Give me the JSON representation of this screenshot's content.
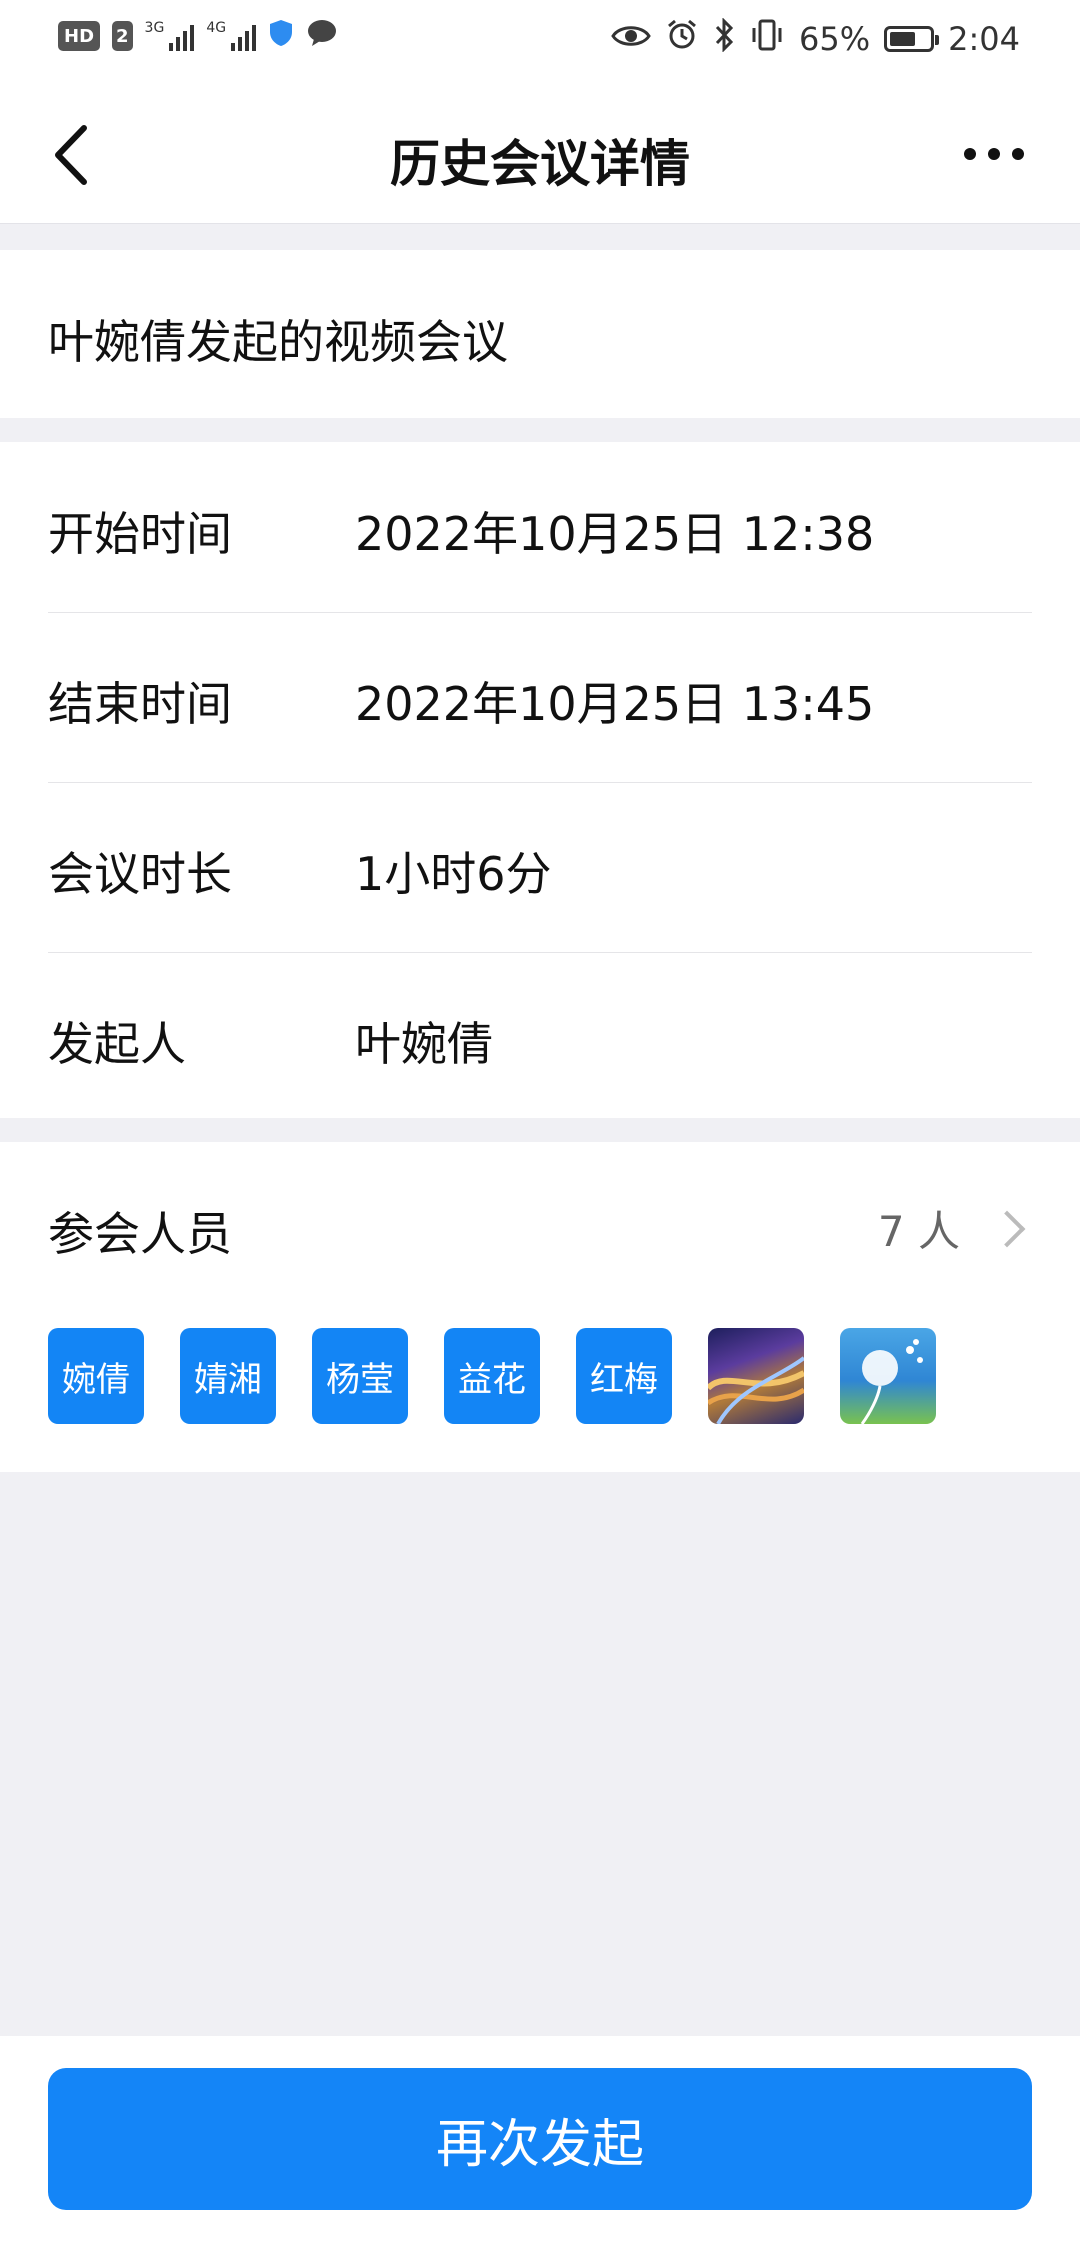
{
  "status_bar": {
    "hd_label": "HD",
    "sim_label": "2",
    "signal1_label": "3G",
    "signal2_label": "4G",
    "battery_percent": "65%",
    "battery_level": 0.65,
    "time": "2:04"
  },
  "header": {
    "title": "历史会议详情"
  },
  "meeting": {
    "title": "叶婉倩发起的视频会议"
  },
  "info": [
    {
      "label": "开始时间",
      "value": "2022年10月25日 12:38"
    },
    {
      "label": "结束时间",
      "value": "2022年10月25日 13:45"
    },
    {
      "label": "会议时长",
      "value": "1小时6分"
    },
    {
      "label": "发起人",
      "value": "叶婉倩"
    }
  ],
  "participants": {
    "title": "参会人员",
    "count": "7 人",
    "avatars": [
      {
        "name": "婉倩"
      },
      {
        "name": "婧湘"
      },
      {
        "name": "杨莹"
      },
      {
        "name": "益花"
      },
      {
        "name": "红梅"
      }
    ]
  },
  "actions": {
    "restart_label": "再次发起"
  },
  "colors": {
    "accent": "#1485f7",
    "background": "#f0f0f4"
  }
}
